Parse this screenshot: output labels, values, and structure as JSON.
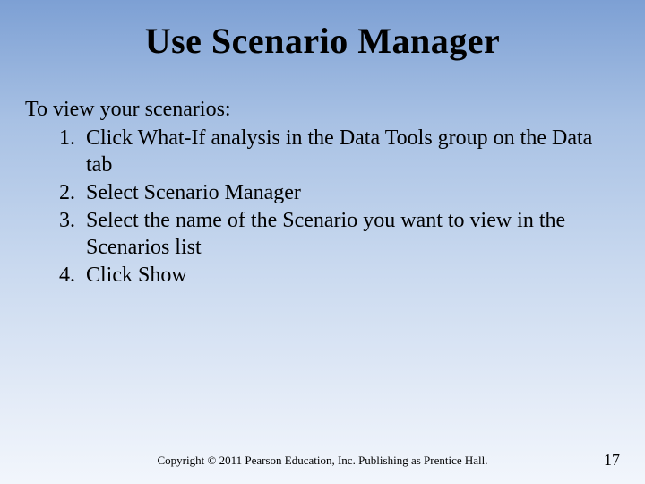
{
  "title": "Use Scenario Manager",
  "intro": "To view your scenarios:",
  "steps": [
    "Click What-If analysis in the Data Tools group on the Data tab",
    "Select Scenario Manager",
    "Select the name of the Scenario you want to view in the Scenarios list",
    "Click Show"
  ],
  "footer": "Copyright © 2011 Pearson Education, Inc. Publishing as Prentice Hall.",
  "page_number": "17"
}
